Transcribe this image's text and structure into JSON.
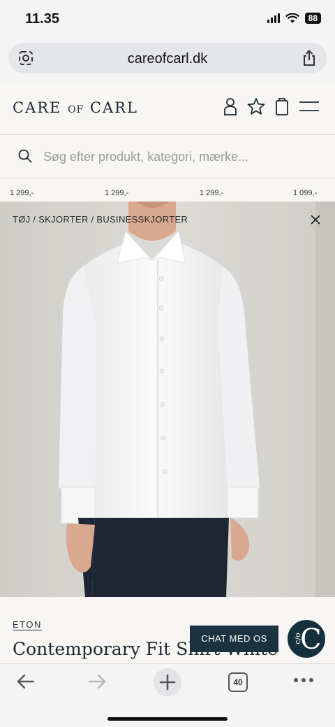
{
  "status": {
    "time": "11.35",
    "battery": "88"
  },
  "browser": {
    "url": "careofcarl.dk",
    "tab_count": "40"
  },
  "header": {
    "logo_part1": "CARE ",
    "logo_part2": "OF",
    "logo_part3": " CARL"
  },
  "search": {
    "placeholder": "Søg efter produkt, kategori, mærke..."
  },
  "prices": [
    "1 299,-",
    "1 299,-",
    "1 299,-",
    "1 099,-"
  ],
  "breadcrumb": "TØJ / SKJORTER / BUSINESSKJORTER",
  "product": {
    "brand": "ETON",
    "title": "Contemporary Fit Shirt White"
  },
  "chat": {
    "label": "CHAT MED OS",
    "avatar_small": "c/o",
    "avatar_big": "C"
  },
  "colors": {
    "navy": "#1b3340",
    "background": "#f7f6f2",
    "image_bg": "#d8d6d1"
  }
}
